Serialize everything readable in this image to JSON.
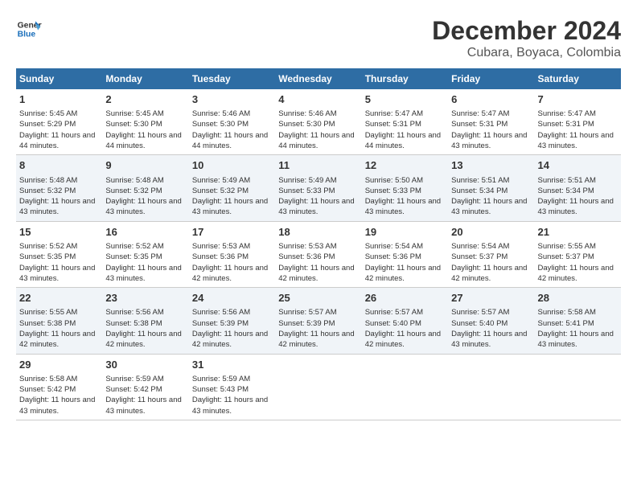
{
  "header": {
    "logo_line1": "General",
    "logo_line2": "Blue",
    "title": "December 2024",
    "subtitle": "Cubara, Boyaca, Colombia"
  },
  "calendar": {
    "days_of_week": [
      "Sunday",
      "Monday",
      "Tuesday",
      "Wednesday",
      "Thursday",
      "Friday",
      "Saturday"
    ],
    "weeks": [
      [
        null,
        null,
        null,
        null,
        null,
        null,
        null
      ]
    ],
    "cells": {
      "w1": [
        {
          "day": "1",
          "sunrise": "5:45 AM",
          "sunset": "5:29 PM",
          "daylight": "11 hours and 44 minutes."
        },
        {
          "day": "2",
          "sunrise": "5:45 AM",
          "sunset": "5:30 PM",
          "daylight": "11 hours and 44 minutes."
        },
        {
          "day": "3",
          "sunrise": "5:46 AM",
          "sunset": "5:30 PM",
          "daylight": "11 hours and 44 minutes."
        },
        {
          "day": "4",
          "sunrise": "5:46 AM",
          "sunset": "5:30 PM",
          "daylight": "11 hours and 44 minutes."
        },
        {
          "day": "5",
          "sunrise": "5:47 AM",
          "sunset": "5:31 PM",
          "daylight": "11 hours and 44 minutes."
        },
        {
          "day": "6",
          "sunrise": "5:47 AM",
          "sunset": "5:31 PM",
          "daylight": "11 hours and 43 minutes."
        },
        {
          "day": "7",
          "sunrise": "5:47 AM",
          "sunset": "5:31 PM",
          "daylight": "11 hours and 43 minutes."
        }
      ],
      "w2": [
        {
          "day": "8",
          "sunrise": "5:48 AM",
          "sunset": "5:32 PM",
          "daylight": "11 hours and 43 minutes."
        },
        {
          "day": "9",
          "sunrise": "5:48 AM",
          "sunset": "5:32 PM",
          "daylight": "11 hours and 43 minutes."
        },
        {
          "day": "10",
          "sunrise": "5:49 AM",
          "sunset": "5:32 PM",
          "daylight": "11 hours and 43 minutes."
        },
        {
          "day": "11",
          "sunrise": "5:49 AM",
          "sunset": "5:33 PM",
          "daylight": "11 hours and 43 minutes."
        },
        {
          "day": "12",
          "sunrise": "5:50 AM",
          "sunset": "5:33 PM",
          "daylight": "11 hours and 43 minutes."
        },
        {
          "day": "13",
          "sunrise": "5:51 AM",
          "sunset": "5:34 PM",
          "daylight": "11 hours and 43 minutes."
        },
        {
          "day": "14",
          "sunrise": "5:51 AM",
          "sunset": "5:34 PM",
          "daylight": "11 hours and 43 minutes."
        }
      ],
      "w3": [
        {
          "day": "15",
          "sunrise": "5:52 AM",
          "sunset": "5:35 PM",
          "daylight": "11 hours and 43 minutes."
        },
        {
          "day": "16",
          "sunrise": "5:52 AM",
          "sunset": "5:35 PM",
          "daylight": "11 hours and 43 minutes."
        },
        {
          "day": "17",
          "sunrise": "5:53 AM",
          "sunset": "5:36 PM",
          "daylight": "11 hours and 42 minutes."
        },
        {
          "day": "18",
          "sunrise": "5:53 AM",
          "sunset": "5:36 PM",
          "daylight": "11 hours and 42 minutes."
        },
        {
          "day": "19",
          "sunrise": "5:54 AM",
          "sunset": "5:36 PM",
          "daylight": "11 hours and 42 minutes."
        },
        {
          "day": "20",
          "sunrise": "5:54 AM",
          "sunset": "5:37 PM",
          "daylight": "11 hours and 42 minutes."
        },
        {
          "day": "21",
          "sunrise": "5:55 AM",
          "sunset": "5:37 PM",
          "daylight": "11 hours and 42 minutes."
        }
      ],
      "w4": [
        {
          "day": "22",
          "sunrise": "5:55 AM",
          "sunset": "5:38 PM",
          "daylight": "11 hours and 42 minutes."
        },
        {
          "day": "23",
          "sunrise": "5:56 AM",
          "sunset": "5:38 PM",
          "daylight": "11 hours and 42 minutes."
        },
        {
          "day": "24",
          "sunrise": "5:56 AM",
          "sunset": "5:39 PM",
          "daylight": "11 hours and 42 minutes."
        },
        {
          "day": "25",
          "sunrise": "5:57 AM",
          "sunset": "5:39 PM",
          "daylight": "11 hours and 42 minutes."
        },
        {
          "day": "26",
          "sunrise": "5:57 AM",
          "sunset": "5:40 PM",
          "daylight": "11 hours and 42 minutes."
        },
        {
          "day": "27",
          "sunrise": "5:57 AM",
          "sunset": "5:40 PM",
          "daylight": "11 hours and 43 minutes."
        },
        {
          "day": "28",
          "sunrise": "5:58 AM",
          "sunset": "5:41 PM",
          "daylight": "11 hours and 43 minutes."
        }
      ],
      "w5": [
        {
          "day": "29",
          "sunrise": "5:58 AM",
          "sunset": "5:42 PM",
          "daylight": "11 hours and 43 minutes."
        },
        {
          "day": "30",
          "sunrise": "5:59 AM",
          "sunset": "5:42 PM",
          "daylight": "11 hours and 43 minutes."
        },
        {
          "day": "31",
          "sunrise": "5:59 AM",
          "sunset": "5:43 PM",
          "daylight": "11 hours and 43 minutes."
        },
        null,
        null,
        null,
        null
      ]
    },
    "labels": {
      "sunrise": "Sunrise:",
      "sunset": "Sunset:",
      "daylight": "Daylight:"
    }
  }
}
